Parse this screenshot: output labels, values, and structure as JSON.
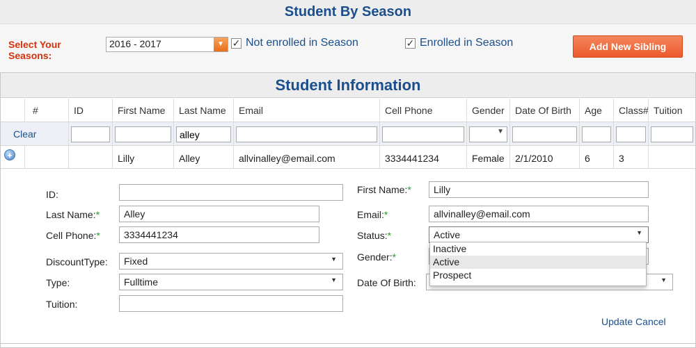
{
  "page_title": "Student By Season",
  "season": {
    "label": "Select Your Seasons:",
    "selected": "2016 - 2017",
    "not_enrolled_label": "Not enrolled in Season",
    "enrolled_label": "Enrolled in Season",
    "add_button": "Add New Sibling"
  },
  "grid": {
    "title": "Student Information",
    "columns": [
      "#",
      "ID",
      "First Name",
      "Last Name",
      "Email",
      "Cell Phone",
      "Gender",
      "Date Of Birth",
      "Age",
      "Class#",
      "Tuition"
    ],
    "filter": {
      "clear_label": "Clear",
      "last_name_value": "alley"
    },
    "row": {
      "first_name": "Lilly",
      "last_name": "Alley",
      "email": "allvinalley@email.com",
      "cell_phone": "3334441234",
      "gender": "Female",
      "dob": "2/1/2010",
      "age": "6",
      "class": "3"
    }
  },
  "form": {
    "id_label": "ID:",
    "id_value": "",
    "last_name_label": "Last Name:",
    "last_name_value": "Alley",
    "cell_phone_label": "Cell Phone:",
    "cell_phone_value": "3334441234",
    "discount_type_label": "DiscountType:",
    "discount_type_value": "Fixed",
    "type_label": "Type:",
    "type_value": "Fulltime",
    "tuition_label": "Tuition:",
    "tuition_value": "",
    "first_name_label": "First Name:",
    "first_name_value": "Lilly",
    "email_label": "Email:",
    "email_value": "allvinalley@email.com",
    "status_label": "Status:",
    "status_value": "Active",
    "gender_label": "Gender:",
    "dob_label": "Date Of Birth:",
    "required_mark": "*",
    "status_options": [
      "Inactive",
      "Active",
      "Prospect"
    ],
    "update_label": "Update",
    "cancel_label": "Cancel"
  }
}
